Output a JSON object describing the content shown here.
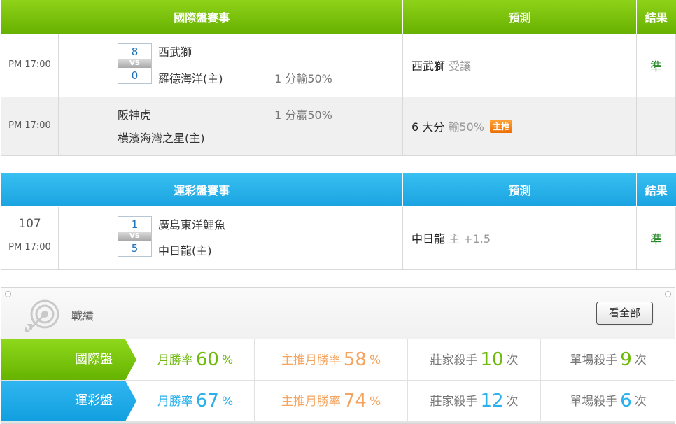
{
  "international": {
    "header": {
      "event": "國際盤賽事",
      "prediction": "預測",
      "result": "結果"
    },
    "rows": [
      {
        "time": "PM 17:00",
        "score_away": "8",
        "vs": "VS",
        "score_home": "0",
        "team_away": "西武獅",
        "team_home": "羅德海洋(主)",
        "handicap": "1 分輸50%",
        "pick_main": "西武獅",
        "pick_sub": "受讓",
        "result": "準"
      },
      {
        "time": "PM 17:00",
        "team_away": "阪神虎",
        "team_home": "橫濱海灣之星(主)",
        "handicap": "1 分贏50%",
        "pick_main": "6 大分",
        "pick_sub": "輸50%",
        "badge": "主推",
        "result": ""
      }
    ]
  },
  "lottery": {
    "header": {
      "event": "運彩盤賽事",
      "prediction": "預測",
      "result": "結果"
    },
    "rows": [
      {
        "number": "107",
        "time": "PM 17:00",
        "score_away": "1",
        "vs": "VS",
        "score_home": "5",
        "team_away": "廣島東洋鯉魚",
        "team_home": "中日龍(主)",
        "pick_main": "中日龍",
        "pick_sub": "主 +1.5",
        "result": "準"
      }
    ]
  },
  "stats": {
    "title": "戰績",
    "view_all": "看全部",
    "icon": "target-icon",
    "rows": [
      {
        "label": "國際盤",
        "monthly_label": "月勝率",
        "monthly_value": "60",
        "monthly_unit": "%",
        "featured_label": "主推月勝率",
        "featured_value": "58",
        "featured_unit": "%",
        "banker_label": "莊家殺手",
        "banker_value": "10",
        "banker_unit": "次",
        "single_label": "單場殺手",
        "single_value": "9",
        "single_unit": "次"
      },
      {
        "label": "運彩盤",
        "monthly_label": "月勝率",
        "monthly_value": "67",
        "monthly_unit": "%",
        "featured_label": "主推月勝率",
        "featured_value": "74",
        "featured_unit": "%",
        "banker_label": "莊家殺手",
        "banker_value": "12",
        "banker_unit": "次",
        "single_label": "單場殺手",
        "single_value": "6",
        "single_unit": "次"
      }
    ]
  },
  "colors": {
    "intl_header": "#7cc30c",
    "lottery_header": "#25b1ea",
    "win": "#2a8a2a",
    "badge": "#f58a1f"
  }
}
